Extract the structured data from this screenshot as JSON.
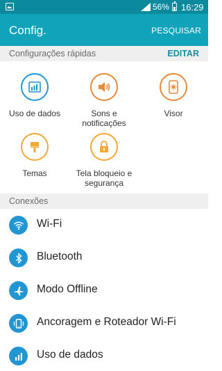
{
  "status_bar": {
    "battery_percent": "56%",
    "time": "16:29"
  },
  "app_bar": {
    "title": "Config.",
    "search_label": "PESQUISAR"
  },
  "quick_settings": {
    "header": "Configurações rápidas",
    "edit_label": "EDITAR",
    "items": [
      {
        "label_line1": "Uso de dados",
        "label_line2": "",
        "icon": "data-usage-icon",
        "color": "#2196d3"
      },
      {
        "label_line1": "Sons e",
        "label_line2": "notificações",
        "icon": "volume-icon",
        "color": "#e8893a"
      },
      {
        "label_line1": "Visor",
        "label_line2": "",
        "icon": "display-icon",
        "color": "#e8893a"
      },
      {
        "label_line1": "Temas",
        "label_line2": "",
        "icon": "paint-brush-icon",
        "color": "#f3a833"
      },
      {
        "label_line1": "Tela bloqueio e",
        "label_line2": "segurança",
        "icon": "lock-icon",
        "color": "#f3a833"
      }
    ]
  },
  "connections": {
    "header": "Conexões",
    "items": [
      {
        "label": "Wi-Fi",
        "icon": "wifi-icon"
      },
      {
        "label": "Bluetooth",
        "icon": "bluetooth-icon"
      },
      {
        "label": "Modo Offline",
        "icon": "airplane-icon"
      },
      {
        "label": "Ancoragem e Roteador Wi-Fi",
        "icon": "tethering-icon"
      },
      {
        "label": "Uso de dados",
        "icon": "data-usage-icon"
      }
    ]
  }
}
